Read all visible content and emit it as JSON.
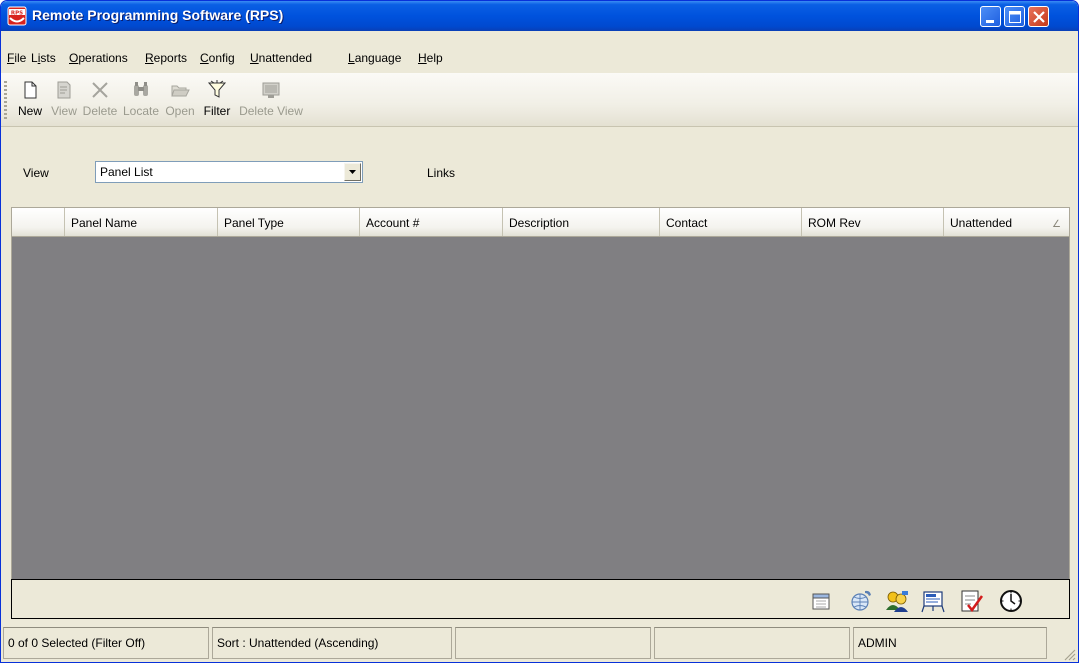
{
  "window": {
    "title": "Remote Programming Software (RPS)",
    "app_icon_text": "RPS"
  },
  "menu": [
    {
      "label": "File",
      "mnemonic_index": 0
    },
    {
      "label": "Lists",
      "mnemonic_index": 1
    },
    {
      "label": "Operations",
      "mnemonic_index": 0
    },
    {
      "label": "Reports",
      "mnemonic_index": 0
    },
    {
      "label": "Config",
      "mnemonic_index": 0
    },
    {
      "label": "Unattended",
      "mnemonic_index": 0
    },
    {
      "label": "Language",
      "mnemonic_index": 0
    },
    {
      "label": "Help",
      "mnemonic_index": 0
    }
  ],
  "toolbar": {
    "buttons": [
      {
        "label": "New",
        "icon": "new-document-icon",
        "enabled": true
      },
      {
        "label": "View",
        "icon": "view-document-icon",
        "enabled": false
      },
      {
        "label": "Delete",
        "icon": "delete-x-icon",
        "enabled": false
      },
      {
        "label": "Locate",
        "icon": "binoculars-icon",
        "enabled": false
      },
      {
        "label": "Open",
        "icon": "open-folder-icon",
        "enabled": false
      },
      {
        "label": "Filter",
        "icon": "funnel-icon",
        "enabled": true
      },
      {
        "label": "Delete View",
        "icon": "delete-view-icon",
        "enabled": false
      }
    ]
  },
  "view_row": {
    "view_label": "View",
    "selected_view": "Panel List",
    "links_label": "Links"
  },
  "table": {
    "columns": [
      "",
      "Panel Name",
      "Panel Type",
      "Account #",
      "Description",
      "Contact",
      "ROM Rev",
      "Unattended"
    ],
    "sort_indicator": "∠",
    "rows": []
  },
  "icon_strip": [
    {
      "icon": "calendar-icon"
    },
    {
      "icon": "globe-phone-icon"
    },
    {
      "icon": "users-icon"
    },
    {
      "icon": "presentation-icon"
    },
    {
      "icon": "checklist-icon"
    },
    {
      "icon": "clock-icon"
    }
  ],
  "status": {
    "selection": "0 of 0 Selected (Filter Off)",
    "sort": "Sort : Unattended (Ascending)",
    "pane3": "",
    "pane4": "",
    "user": "ADMIN"
  },
  "colors": {
    "title_bar": "#0052dd",
    "chrome": "#ece9d8",
    "grid_body": "#807f82"
  }
}
